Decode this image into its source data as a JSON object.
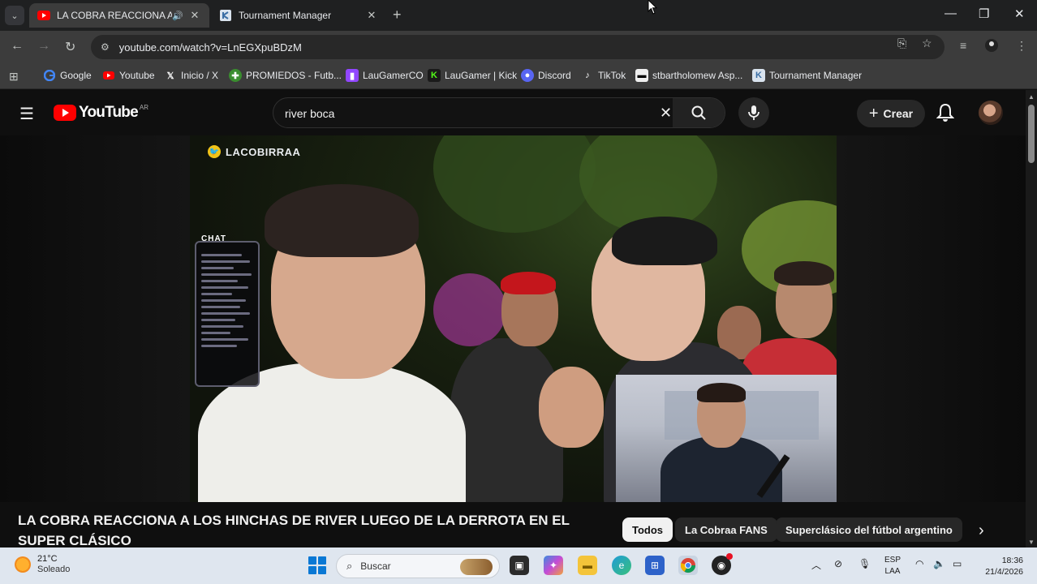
{
  "browser": {
    "tabs": [
      {
        "title": "LA COBRA REACCIONA A LO",
        "active": true,
        "audio_icon": "speaker-icon"
      },
      {
        "title": "Tournament Manager",
        "active": false
      }
    ],
    "url": "youtube.com/watch?v=LnEGXpuBDzM",
    "bookmarks": [
      {
        "label": "Google",
        "icon": "google-icon"
      },
      {
        "label": "Youtube",
        "icon": "youtube-icon"
      },
      {
        "label": "Inicio / X",
        "icon": "x-icon"
      },
      {
        "label": "PROMIEDOS - Futb...",
        "icon": "promiedos-icon"
      },
      {
        "label": "LauGamerCO",
        "icon": "twitch-icon"
      },
      {
        "label": "LauGamer | Kick",
        "icon": "kick-icon"
      },
      {
        "label": "Discord",
        "icon": "discord-icon"
      },
      {
        "label": "TikTok",
        "icon": "tiktok-icon"
      },
      {
        "label": "stbartholomew Asp...",
        "icon": "site-icon"
      },
      {
        "label": "Tournament Manager",
        "icon": "tournament-icon"
      }
    ]
  },
  "youtube": {
    "logo_text": "YouTube",
    "country_code": "AR",
    "search_query": "river boca",
    "create_label": "Crear",
    "video": {
      "overlay_handle": "LACOBIRRAA",
      "chat_label": "CHAT",
      "title": "LA COBRA REACCIONA A LOS HINCHAS DE RIVER LUEGO DE LA DERROTA EN EL SUPER CLÁSICO"
    },
    "chips": [
      {
        "label": "Todos",
        "selected": true
      },
      {
        "label": "La Cobraa FANS",
        "selected": false
      },
      {
        "label": "Superclásico del fútbol argentino",
        "selected": false
      }
    ]
  },
  "taskbar": {
    "weather_temp": "21°C",
    "weather_desc": "Soleado",
    "search_placeholder": "Buscar",
    "lang_line1": "ESP",
    "lang_line2": "LAA",
    "time": "18:36",
    "date": "21/4/2026"
  },
  "colors": {
    "youtube_red": "#ff0000",
    "chrome_dark": "#1f2021",
    "toolbar": "#3c3c3c",
    "taskbar": "#dfe6ef"
  }
}
